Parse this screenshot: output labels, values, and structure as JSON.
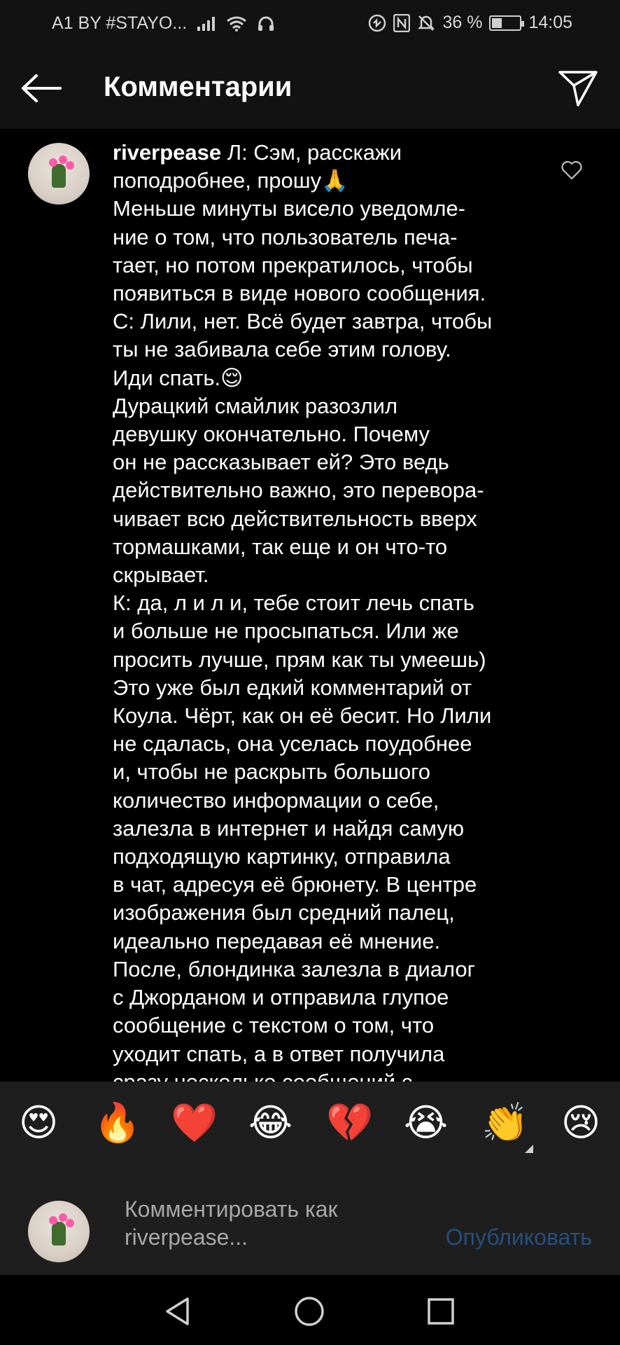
{
  "status_bar": {
    "carrier": "A1 BY #STAYO...",
    "battery_percent": "36 %",
    "battery_level": 0.36,
    "time": "14:05",
    "icons": [
      "signal-icon",
      "wifi-icon",
      "headset-icon",
      "nfc-icon",
      "mute-icon",
      "battery-icon"
    ]
  },
  "header": {
    "title": "Комментарии",
    "back_icon": "arrow-left-icon",
    "send_icon": "paper-plane-icon"
  },
  "comment": {
    "username": "riverpease",
    "text": " Л: Сэм, расскажи\nпоподробнее, прошу🙏\nМеньше минуты висело уведомле-\nние о том, что пользователь печа-\nтает, но потом прекратилось, чтобы\nпоявиться в виде нового сообщения.\nС: Лили, нет. Всё будет завтра, чтобы\nты не забивала себе этим голову.\nИди спать.😌\nДурацкий смайлик разозлил\nдевушку окончательно. Почему\nон не рассказывает ей? Это ведь\nдействительно важно, это перевора-\nчивает всю действительность вверх\nтормашками, так еще и он что-то\nскрывает.\nК: да, л и л и, тебе стоит лечь спать\nи больше не просыпаться. Или же\nпросить лучше, прям как ты умеешь)\nЭто уже был едкий комментарий от\nКоула. Чёрт, как он её бесит. Но Лили\nне сдалась, она уселась поудобнее\nи, чтобы не раскрыть большого\nколичество информации о себе,\nзалезла в интернет и найдя самую\nподходящую картинку, отправила\nв чат, адресуя её брюнету. В центре\nизображения был средний палец,\nидеально передавая её мнение.\nПосле, блондинка залезла в диалог\nс Джорданом и отправила глупое\nсообщение с текстом о том, что\nуходит спать, а в ответ получила\nсразу несколько сообщений с",
    "like_icon": "heart-outline-icon"
  },
  "emoji_bar": {
    "emojis": [
      "😍",
      "🔥",
      "❤️",
      "😂",
      "💔",
      "😭",
      "👏",
      "😢"
    ]
  },
  "composer": {
    "placeholder": "Комментировать как riverpease...",
    "publish_label": "Опубликовать"
  },
  "nav_bar": {
    "icons": [
      "back-triangle-icon",
      "home-circle-icon",
      "recents-square-icon"
    ]
  },
  "colors": {
    "background": "#000000",
    "header_bg": "#121212",
    "composer_bg": "#1e1e1e",
    "publish_disabled": "#24507e",
    "placeholder": "#a8a8a8"
  }
}
